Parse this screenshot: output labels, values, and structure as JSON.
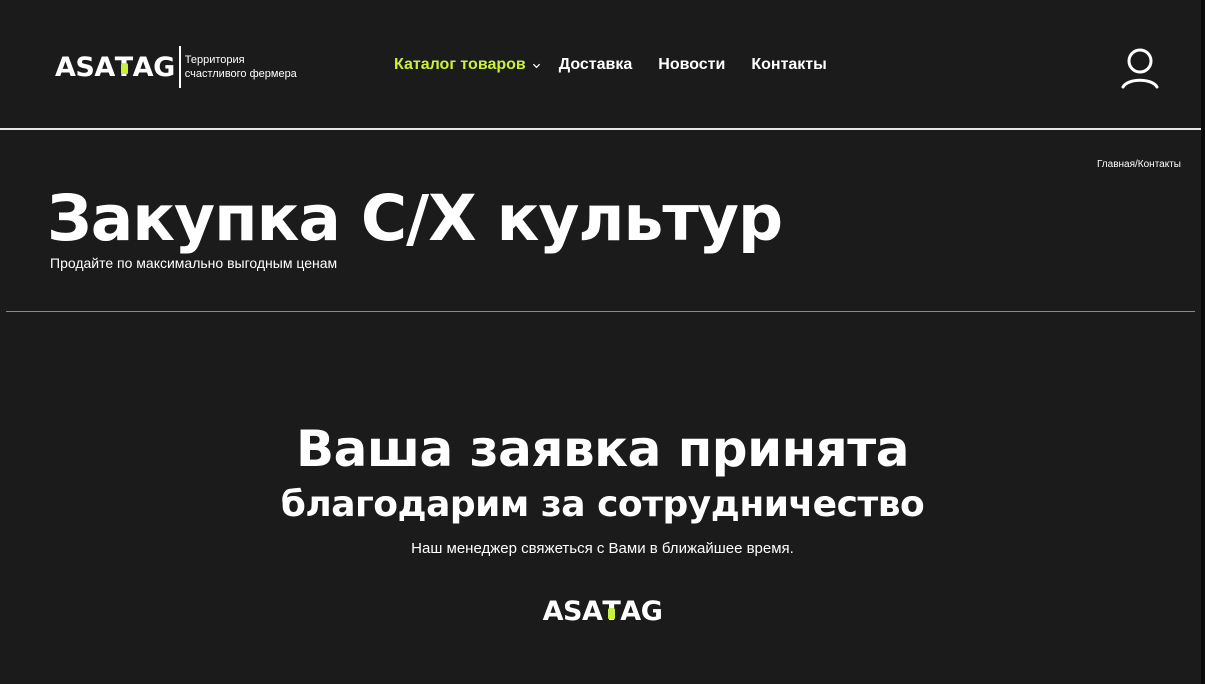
{
  "header": {
    "logo": {
      "prefix": "ASA",
      "t_letter": "T",
      "suffix": "AG",
      "tagline": "Территория\nсчастливого фермера"
    },
    "nav": [
      {
        "label": "Каталог товаров",
        "active": true,
        "has_dropdown": true
      },
      {
        "label": "Доставка",
        "active": false
      },
      {
        "label": "Новости",
        "active": false
      },
      {
        "label": "Контакты",
        "active": false
      }
    ],
    "user_icon": "user-icon"
  },
  "breadcrumb": {
    "home": "Главная",
    "separator": "/",
    "current": "Контакты"
  },
  "hero": {
    "title": "Закупка С/Х культур",
    "subtitle": "Продайте по максимально выгодным ценам"
  },
  "confirmation": {
    "title": "Ваша заявка принята",
    "subtitle": "благодарим за сотрудничество",
    "text": "Наш менеджер свяжеться с Вами в ближайшее время."
  },
  "footer_logo": {
    "prefix": "ASA",
    "t_letter": "T",
    "suffix": "AG"
  },
  "colors": {
    "background": "#1b1b1b",
    "accent": "#c8f03c",
    "text": "#ffffff"
  }
}
